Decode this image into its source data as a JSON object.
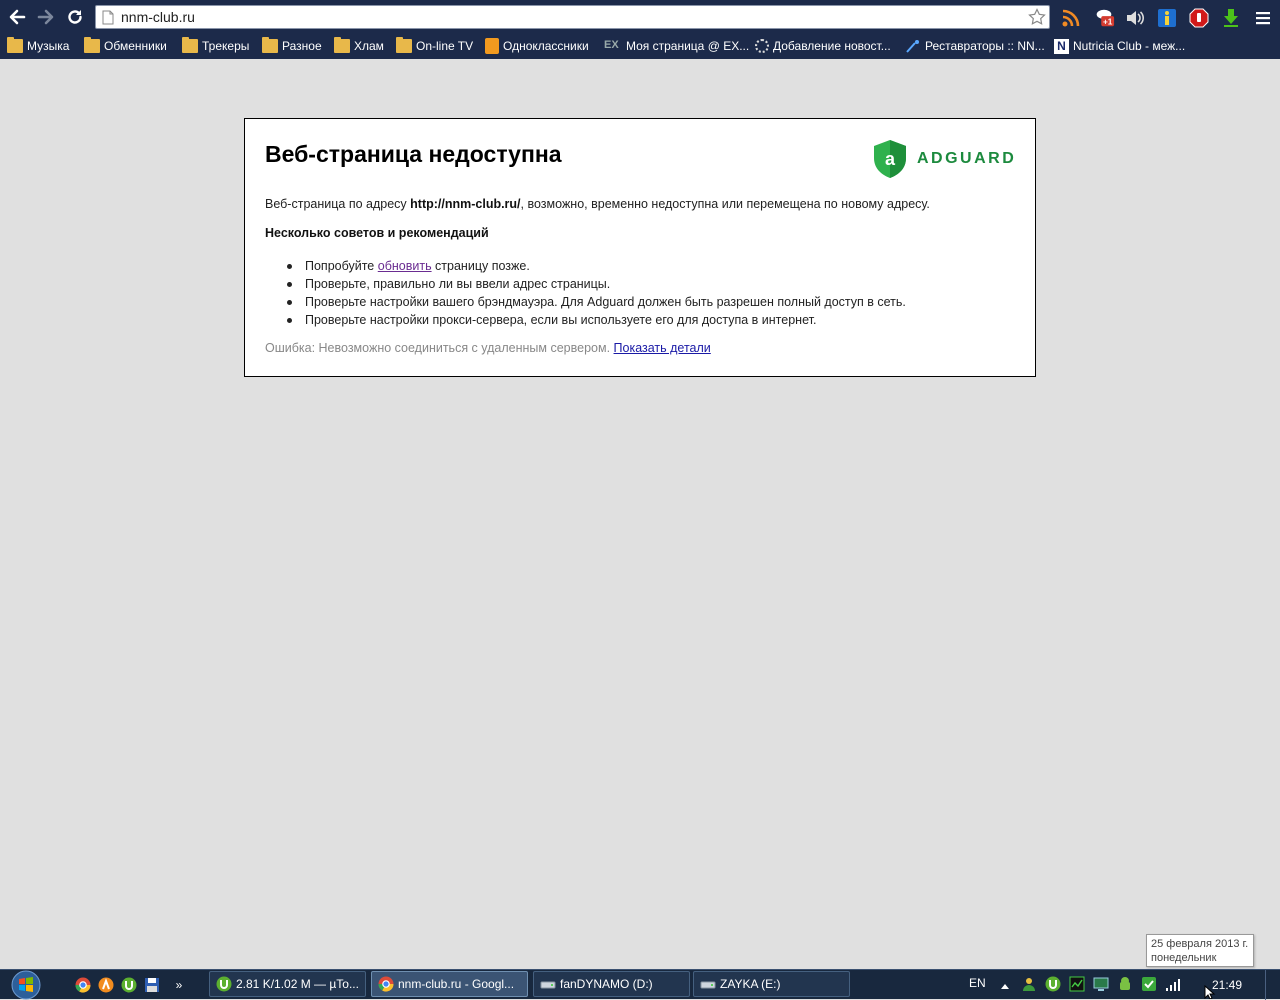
{
  "browser": {
    "url": "nnm-club.ru",
    "bookmarks": [
      {
        "label": "Музыка",
        "icon": "folder-icon"
      },
      {
        "label": "Обменники",
        "icon": "folder-icon"
      },
      {
        "label": "Трекеры",
        "icon": "folder-icon"
      },
      {
        "label": "Разное",
        "icon": "folder-icon"
      },
      {
        "label": "Хлам",
        "icon": "folder-icon"
      },
      {
        "label": "On-line TV",
        "icon": "folder-icon"
      },
      {
        "label": "Одноклассники",
        "icon": "odnoklassniki-icon"
      },
      {
        "label": "Моя страница @ EX...",
        "icon": "ex-icon"
      },
      {
        "label": "Добавление новост...",
        "icon": "gear-icon"
      },
      {
        "label": "Реставраторы :: NN...",
        "icon": "brush-icon"
      },
      {
        "label": "Nutricia Club - меж...",
        "icon": "nutricia-icon"
      }
    ]
  },
  "error_page": {
    "title": "Веб-страница недоступна",
    "logo_text": "ADGUARD",
    "desc_prefix": "Веб-страница по адресу ",
    "desc_url": "http://nnm-club.ru/",
    "desc_suffix": ", возможно, временно недоступна или перемещена по новому адресу.",
    "tips_heading": "Несколько советов и рекомендаций",
    "tip1_prefix": "Попробуйте ",
    "tip1_link": "обновить",
    "tip1_suffix": " страницу позже.",
    "tips": [
      "Проверьте, правильно ли вы ввели адрес страницы.",
      "Проверьте настройки вашего брэндмауэра. Для Adguard должен быть разрешен полный доступ в сеть.",
      "Проверьте настройки прокси-сервера, если вы используете его для доступа в интернет."
    ],
    "error_text": "Ошибка: Невозможно соединиться с удаленным сервером.",
    "details_link": "Показать детали"
  },
  "tooltip": {
    "date": "25 февраля 2013 г.",
    "weekday": "понедельник"
  },
  "taskbar": {
    "buttons": [
      {
        "label": "2.81 K/1.02 M — µTo...",
        "icon": "utorrent-icon"
      },
      {
        "label": "nnm-club.ru - Googl...",
        "icon": "chrome-icon"
      },
      {
        "label": "fanDYNAMO (D:)",
        "icon": "drive-icon"
      },
      {
        "label": "ZAYKA (E:)",
        "icon": "drive-icon"
      }
    ],
    "overflow": "»",
    "lang": "EN",
    "time": "21:49"
  }
}
